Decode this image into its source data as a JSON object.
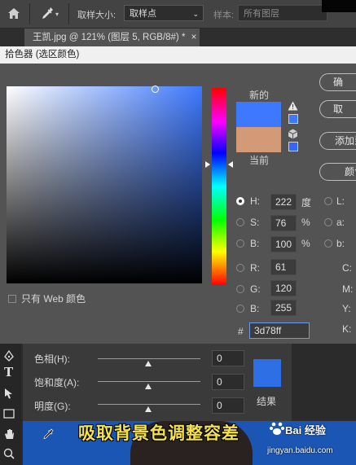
{
  "options_bar": {
    "sample_size_label": "取样大小:",
    "sample_size_value": "取样点",
    "sample_label": "样本:",
    "sample_value": "所有图层"
  },
  "document_tab": {
    "title": "王凯.jpg @ 121% (图层 5, RGB/8#) *",
    "close": "×"
  },
  "dialog": {
    "title": "拾色器 (选区颜色)",
    "new_label": "新的",
    "current_label": "当前",
    "web_only_label": "只有 Web 颜色",
    "buttons": {
      "ok": "确",
      "cancel": "取",
      "add_to_swatches": "添加到",
      "color_libraries": "颜色"
    },
    "hsb": {
      "h": {
        "label": "H:",
        "value": "222",
        "unit": "度"
      },
      "s": {
        "label": "S:",
        "value": "76",
        "unit": "%"
      },
      "b": {
        "label": "B:",
        "value": "100",
        "unit": "%"
      }
    },
    "rgb": {
      "r": {
        "label": "R:",
        "value": "61"
      },
      "g": {
        "label": "G:",
        "value": "120"
      },
      "b": {
        "label": "B:",
        "value": "255"
      }
    },
    "lab": {
      "l": "L:",
      "a": "a:",
      "b": "b:"
    },
    "cmyk": {
      "c": "C:",
      "m": "M:",
      "y": "Y:",
      "k": "K:"
    },
    "hex_label": "#",
    "hex_value": "3d78ff",
    "new_color": "#3d78ff",
    "current_color": "#d39a78"
  },
  "hue_panel": {
    "hue_label": "色相(H):",
    "hue_value": "0",
    "saturation_label": "饱和度(A):",
    "saturation_value": "0",
    "lightness_label": "明度(G):",
    "lightness_value": "0",
    "result_label": "结果",
    "result_color": "#2f6fe6"
  },
  "caption": "吸取背景色调整容差",
  "watermark": {
    "logo": "Bai 经验",
    "url": "jingyan.baidu.com"
  }
}
